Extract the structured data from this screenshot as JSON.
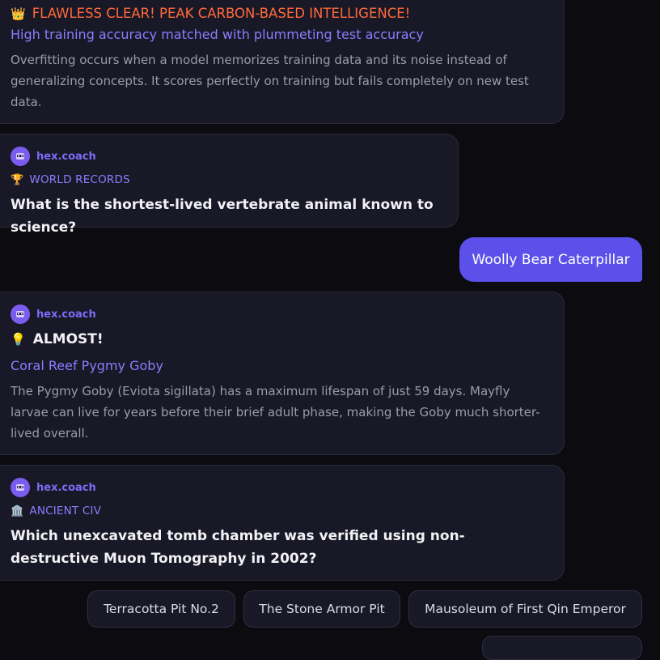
{
  "messages": [
    {
      "emoji": "👑",
      "title": "FLAWLESS CLEAR! PEAK CARBON-BASED INTELLIGENCE!",
      "answer": "High training accuracy matched with plummeting test accuracy",
      "explanation": "Overfitting occurs when a model memorizes training data and its noise instead of generalizing concepts. It scores perfectly on training but fails completely on new test data."
    },
    {
      "sender": "hex.coach",
      "category_emoji": "🏆",
      "category": "WORLD RECORDS",
      "question": "What is the shortest-lived vertebrate animal known to science?"
    },
    {
      "user_answer": "Woolly Bear Caterpillar"
    },
    {
      "sender": "hex.coach",
      "emoji": "💡",
      "title": "ALMOST!",
      "answer": "Coral Reef Pygmy Goby",
      "explanation": "The Pygmy Goby (Eviota sigillata) has a maximum lifespan of just 59 days. Mayfly larvae can live for years before their brief adult phase, making the Goby much shorter-lived overall."
    },
    {
      "sender": "hex.coach",
      "category_emoji": "🏛️",
      "category": "ANCIENT CIV",
      "question": "Which unexcavated tomb chamber was verified using non-destructive Muon Tomography in 2002?"
    }
  ],
  "options": [
    "Terracotta Pit No.2",
    "The Stone Armor Pit",
    "Mausoleum of First Qin Emperor"
  ],
  "colors": {
    "accent": "#5b51ea",
    "success_title": "#ff6a3d",
    "answer": "#8c7dff",
    "card_bg": "#181826",
    "page_bg": "#0b0b10"
  }
}
